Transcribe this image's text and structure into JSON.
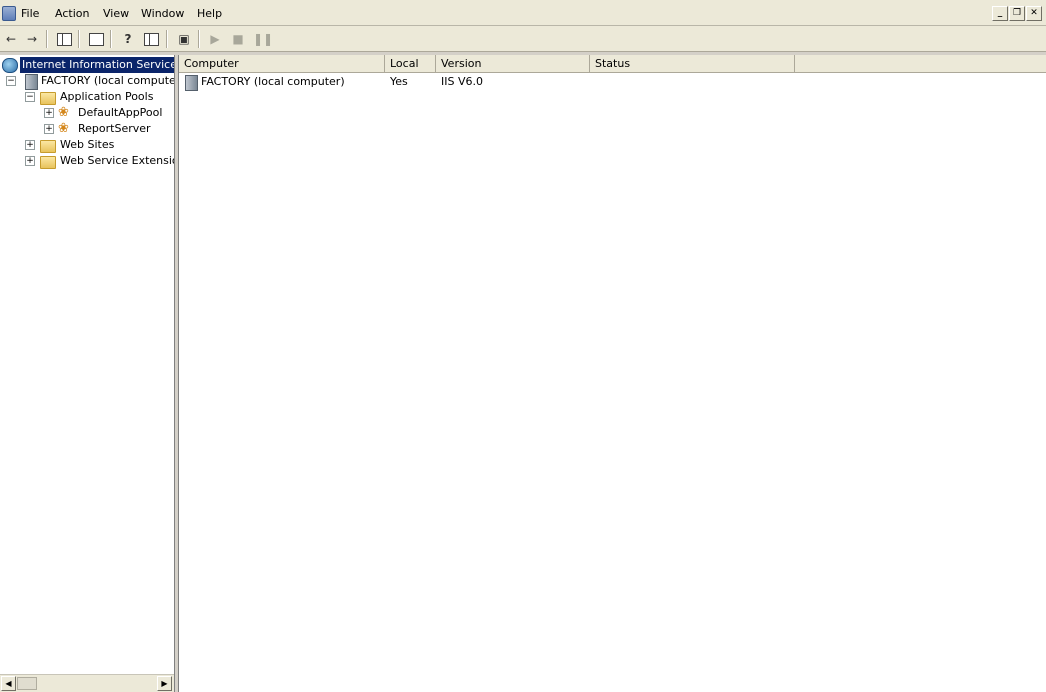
{
  "menubar": {
    "items": [
      "File",
      "Action",
      "View",
      "Window",
      "Help"
    ],
    "window_controls": [
      "_",
      "❐",
      "✕"
    ]
  },
  "toolbar": {
    "buttons": [
      "back-icon",
      "forward-icon",
      "show-hide-console-tree-icon",
      "export-list-icon",
      "help-icon",
      "show-hide-action-pane-icon",
      "computer-icon",
      "start-icon",
      "stop-icon",
      "pause-icon"
    ]
  },
  "tree": {
    "root": "Internet Information Services",
    "computer": "FACTORY (local computer)",
    "app_pools": "Application Pools",
    "pool1": "DefaultAppPool",
    "pool2": "ReportServer",
    "web_sites": "Web Sites",
    "web_ext": "Web Service Extension"
  },
  "list": {
    "columns": [
      "Computer",
      "Local",
      "Version",
      "Status"
    ],
    "rows": [
      {
        "computer": "FACTORY (local computer)",
        "local": "Yes",
        "version": "IIS V6.0",
        "status": ""
      }
    ]
  },
  "colors": {
    "selection": "#0a246a",
    "chrome": "#ece9d8"
  }
}
